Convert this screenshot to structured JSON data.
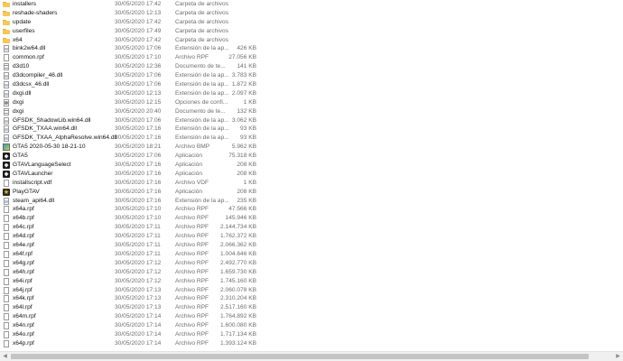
{
  "files": [
    {
      "name": "installers",
      "date": "30/05/2020 17:42",
      "type": "Carpeta de archivos",
      "size": "",
      "icon": "folder"
    },
    {
      "name": "reshade-shaders",
      "date": "30/05/2020 12:13",
      "type": "Carpeta de archivos",
      "size": "",
      "icon": "folder"
    },
    {
      "name": "update",
      "date": "30/05/2020 17:42",
      "type": "Carpeta de archivos",
      "size": "",
      "icon": "folder"
    },
    {
      "name": "userfiles",
      "date": "30/05/2020 17:49",
      "type": "Carpeta de archivos",
      "size": "",
      "icon": "folder"
    },
    {
      "name": "x64",
      "date": "30/05/2020 17:42",
      "type": "Carpeta de archivos",
      "size": "",
      "icon": "folder"
    },
    {
      "name": "bink2w64.dll",
      "date": "30/05/2020 17:06",
      "type": "Extensión de la ap...",
      "size": "426 KB",
      "icon": "dll"
    },
    {
      "name": "common.rpf",
      "date": "30/05/2020 17:10",
      "type": "Archivo RPF",
      "size": "27.056 KB",
      "icon": "file"
    },
    {
      "name": "d3d10",
      "date": "30/05/2020 12:36",
      "type": "Documento de te...",
      "size": "141 KB",
      "icon": "text"
    },
    {
      "name": "d3dcompiler_46.dll",
      "date": "30/05/2020 17:06",
      "type": "Extensión de la ap...",
      "size": "3.783 KB",
      "icon": "dll"
    },
    {
      "name": "d3dcsx_46.dll",
      "date": "30/05/2020 17:06",
      "type": "Extensión de la ap...",
      "size": "1.872 KB",
      "icon": "dll"
    },
    {
      "name": "dxgi.dll",
      "date": "30/05/2020 12:13",
      "type": "Extensión de la ap...",
      "size": "2.097 KB",
      "icon": "dll"
    },
    {
      "name": "dxgi",
      "date": "30/05/2020 12:15",
      "type": "Opciones de confi...",
      "size": "1 KB",
      "icon": "settings"
    },
    {
      "name": "dxgi",
      "date": "30/05/2020 20:40",
      "type": "Documento de te...",
      "size": "132 KB",
      "icon": "text"
    },
    {
      "name": "GFSDK_ShadowLib.win64.dll",
      "date": "30/05/2020 17:06",
      "type": "Extensión de la ap...",
      "size": "3.062 KB",
      "icon": "dll"
    },
    {
      "name": "GFSDK_TXAA.win64.dll",
      "date": "30/05/2020 17:16",
      "type": "Extensión de la ap...",
      "size": "93 KB",
      "icon": "dll"
    },
    {
      "name": "GFSDK_TXAA_AlphaResolve.win64.dll",
      "date": "30/05/2020 17:16",
      "type": "Extensión de la ap...",
      "size": "93 KB",
      "icon": "dll"
    },
    {
      "name": "GTA5 2020-05-30 18-21-10",
      "date": "30/05/2020 18:21",
      "type": "Archivo BMP",
      "size": "5.962 KB",
      "icon": "image"
    },
    {
      "name": "GTA5",
      "date": "30/05/2020 17:06",
      "type": "Aplicación",
      "size": "75.318 KB",
      "icon": "app-gta"
    },
    {
      "name": "GTAVLanguageSelect",
      "date": "30/05/2020 17:16",
      "type": "Aplicación",
      "size": "208 KB",
      "icon": "app-gta"
    },
    {
      "name": "GTAVLauncher",
      "date": "30/05/2020 17:16",
      "type": "Aplicación",
      "size": "208 KB",
      "icon": "app-gta"
    },
    {
      "name": "installscript.vdf",
      "date": "30/05/2020 17:16",
      "type": "Archivo VDF",
      "size": "1 KB",
      "icon": "file"
    },
    {
      "name": "PlayGTAV",
      "date": "30/05/2020 17:16",
      "type": "Aplicación",
      "size": "208 KB",
      "icon": "app-rs"
    },
    {
      "name": "steam_api64.dll",
      "date": "30/05/2020 17:16",
      "type": "Extensión de la ap...",
      "size": "235 KB",
      "icon": "dll"
    },
    {
      "name": "x64a.rpf",
      "date": "30/05/2020 17:10",
      "type": "Archivo RPF",
      "size": "47.566 KB",
      "icon": "file"
    },
    {
      "name": "x64b.rpf",
      "date": "30/05/2020 17:10",
      "type": "Archivo RPF",
      "size": "145.946 KB",
      "icon": "file"
    },
    {
      "name": "x64c.rpf",
      "date": "30/05/2020 17:11",
      "type": "Archivo RPF",
      "size": "2.144.734 KB",
      "icon": "file"
    },
    {
      "name": "x64d.rpf",
      "date": "30/05/2020 17:11",
      "type": "Archivo RPF",
      "size": "1.762.372 KB",
      "icon": "file"
    },
    {
      "name": "x64e.rpf",
      "date": "30/05/2020 17:11",
      "type": "Archivo RPF",
      "size": "2.066.362 KB",
      "icon": "file"
    },
    {
      "name": "x64f.rpf",
      "date": "30/05/2020 17:11",
      "type": "Archivo RPF",
      "size": "1.004.646 KB",
      "icon": "file"
    },
    {
      "name": "x64g.rpf",
      "date": "30/05/2020 17:12",
      "type": "Archivo RPF",
      "size": "2.492.770 KB",
      "icon": "file"
    },
    {
      "name": "x64h.rpf",
      "date": "30/05/2020 17:12",
      "type": "Archivo RPF",
      "size": "1.659.730 KB",
      "icon": "file"
    },
    {
      "name": "x64i.rpf",
      "date": "30/05/2020 17:12",
      "type": "Archivo RPF",
      "size": "1.745.160 KB",
      "icon": "file"
    },
    {
      "name": "x64j.rpf",
      "date": "30/05/2020 17:13",
      "type": "Archivo RPF",
      "size": "2.060.078 KB",
      "icon": "file"
    },
    {
      "name": "x64k.rpf",
      "date": "30/05/2020 17:13",
      "type": "Archivo RPF",
      "size": "2.310.204 KB",
      "icon": "file"
    },
    {
      "name": "x64l.rpf",
      "date": "30/05/2020 17:13",
      "type": "Archivo RPF",
      "size": "2.517.160 KB",
      "icon": "file"
    },
    {
      "name": "x64m.rpf",
      "date": "30/05/2020 17:14",
      "type": "Archivo RPF",
      "size": "1.764.892 KB",
      "icon": "file"
    },
    {
      "name": "x64n.rpf",
      "date": "30/05/2020 17:14",
      "type": "Archivo RPF",
      "size": "1.600.080 KB",
      "icon": "file"
    },
    {
      "name": "x64o.rpf",
      "date": "30/05/2020 17:14",
      "type": "Archivo RPF",
      "size": "1.717.134 KB",
      "icon": "file"
    },
    {
      "name": "x64p.rpf",
      "date": "30/05/2020 17:14",
      "type": "Archivo RPF",
      "size": "1.393.124 KB",
      "icon": "file"
    }
  ],
  "scrollbar": {
    "left_arrow": "◀",
    "right_arrow": "▶"
  }
}
